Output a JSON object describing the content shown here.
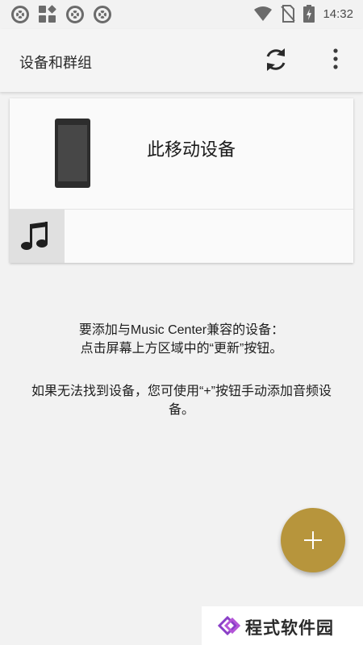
{
  "status_bar": {
    "time": "14:32",
    "left_icons": [
      "film-reel-icon",
      "app-grid-icon",
      "film-reel-icon",
      "film-reel-icon"
    ],
    "right_icons": [
      "wifi-icon",
      "no-sim-icon",
      "battery-charging-icon"
    ]
  },
  "app_bar": {
    "title": "设备和群组",
    "actions": [
      "refresh-icon",
      "more-vert-icon"
    ]
  },
  "device_card": {
    "device_name": "此移动设备",
    "device_icon": "smartphone-icon",
    "source_icon": "music-note-icon"
  },
  "info": {
    "line1": "要添加与Music Center兼容的设备：",
    "line2": "点击屏幕上方区域中的“更新”按钮。",
    "line3": "如果无法找到设备，您可使用“+”按钮手动添加音频设备。"
  },
  "fab": {
    "icon": "plus-icon"
  },
  "watermark": {
    "text": "程式软件园"
  },
  "colors": {
    "background": "#f2f2f2",
    "fab": "#b7953c",
    "text": "#1e1e1e",
    "icon": "#6b6b6b"
  }
}
